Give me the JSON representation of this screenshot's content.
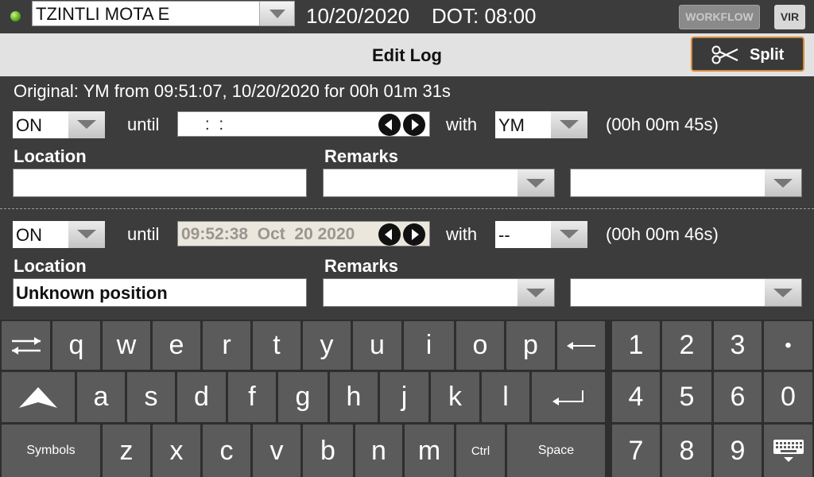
{
  "topbar": {
    "driver": "TZINTLI MOTA E",
    "date": "10/20/2020",
    "dot": "DOT: 08:00",
    "workflow_label": "WORKFLOW",
    "vir_label": "VIR"
  },
  "titlebar": {
    "title": "Edit Log",
    "split_label": "Split"
  },
  "original": "Original: YM from 09:51:07, 10/20/2020 for 00h 01m 31s",
  "segment1": {
    "status": "ON",
    "until_label": "until",
    "time": " :  :",
    "with_label": "with",
    "with_value": "YM",
    "duration": "(00h 00m 45s)",
    "location_label": "Location",
    "location_value": "",
    "remarks_label": "Remarks"
  },
  "segment2": {
    "status": "ON",
    "until_label": "until",
    "time": "09:52:38  Oct  20 2020",
    "with_label": "with",
    "with_value": "--",
    "duration": "(00h 00m 46s)",
    "location_label": "Location",
    "location_value": "Unknown position",
    "remarks_label": "Remarks"
  },
  "keyboard": {
    "row1": [
      "q",
      "w",
      "e",
      "r",
      "t",
      "y",
      "u",
      "i",
      "o",
      "p"
    ],
    "row2": [
      "a",
      "s",
      "d",
      "f",
      "g",
      "h",
      "j",
      "k",
      "l"
    ],
    "row3": [
      "z",
      "x",
      "c",
      "v",
      "b",
      "n",
      "m"
    ],
    "symbols": "Symbols",
    "ctrl": "Ctrl",
    "space": "Space",
    "numpad": [
      "1",
      "2",
      "3",
      "•",
      "4",
      "5",
      "6",
      "0",
      "7",
      "8",
      "9"
    ]
  },
  "colors": {
    "accent_border": "#d88a3a",
    "led_green": "#5aa81c",
    "key_bg": "#5b5b5b",
    "background": "#3c3c3c"
  }
}
